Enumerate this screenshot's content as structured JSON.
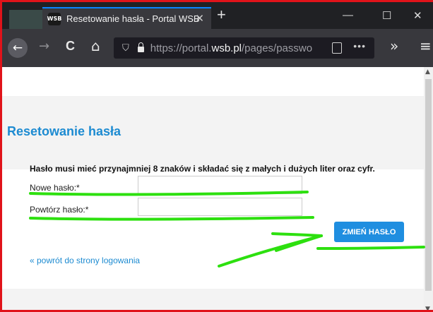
{
  "browser": {
    "tab_favicon_text": "WSB",
    "tab_title": "Resetowanie hasła - Portal WSB",
    "tab_close": "✕",
    "new_tab": "+",
    "window_minimize": "—",
    "window_maximize": "☐",
    "window_close": "✕",
    "nav_back": "←",
    "nav_forward": "→",
    "nav_reload": "C",
    "nav_home": "⌂",
    "url_shield": "⛉",
    "url_prefix": "https://portal.",
    "url_domain": "wsb.pl",
    "url_path": "/pages/passwo",
    "url_more": "•••",
    "overflow": "»",
    "menu": "≡"
  },
  "page": {
    "title": "Resetowanie hasła",
    "password_rule": "Hasło musi mieć przynajmniej 8 znaków i składać się z małych i dużych liter oraz cyfr.",
    "new_password_label": "Nowe hasło:*",
    "new_password_value": "",
    "repeat_password_label": "Powtórz hasło:*",
    "repeat_password_value": "",
    "submit_label": "ZMIEŃ HASŁO",
    "back_link": "« powrót do strony logowania"
  },
  "icons": {
    "back": "arrow-left-icon",
    "forward": "arrow-right-icon",
    "reload": "reload-icon",
    "home": "home-icon",
    "tracking": "shield-icon",
    "secure": "lock-icon",
    "reader": "reader-view-icon"
  },
  "colors": {
    "border": "#e0131a",
    "accent": "#1d8bd1",
    "button": "#1f8ee0",
    "annotation": "#2de00f"
  }
}
